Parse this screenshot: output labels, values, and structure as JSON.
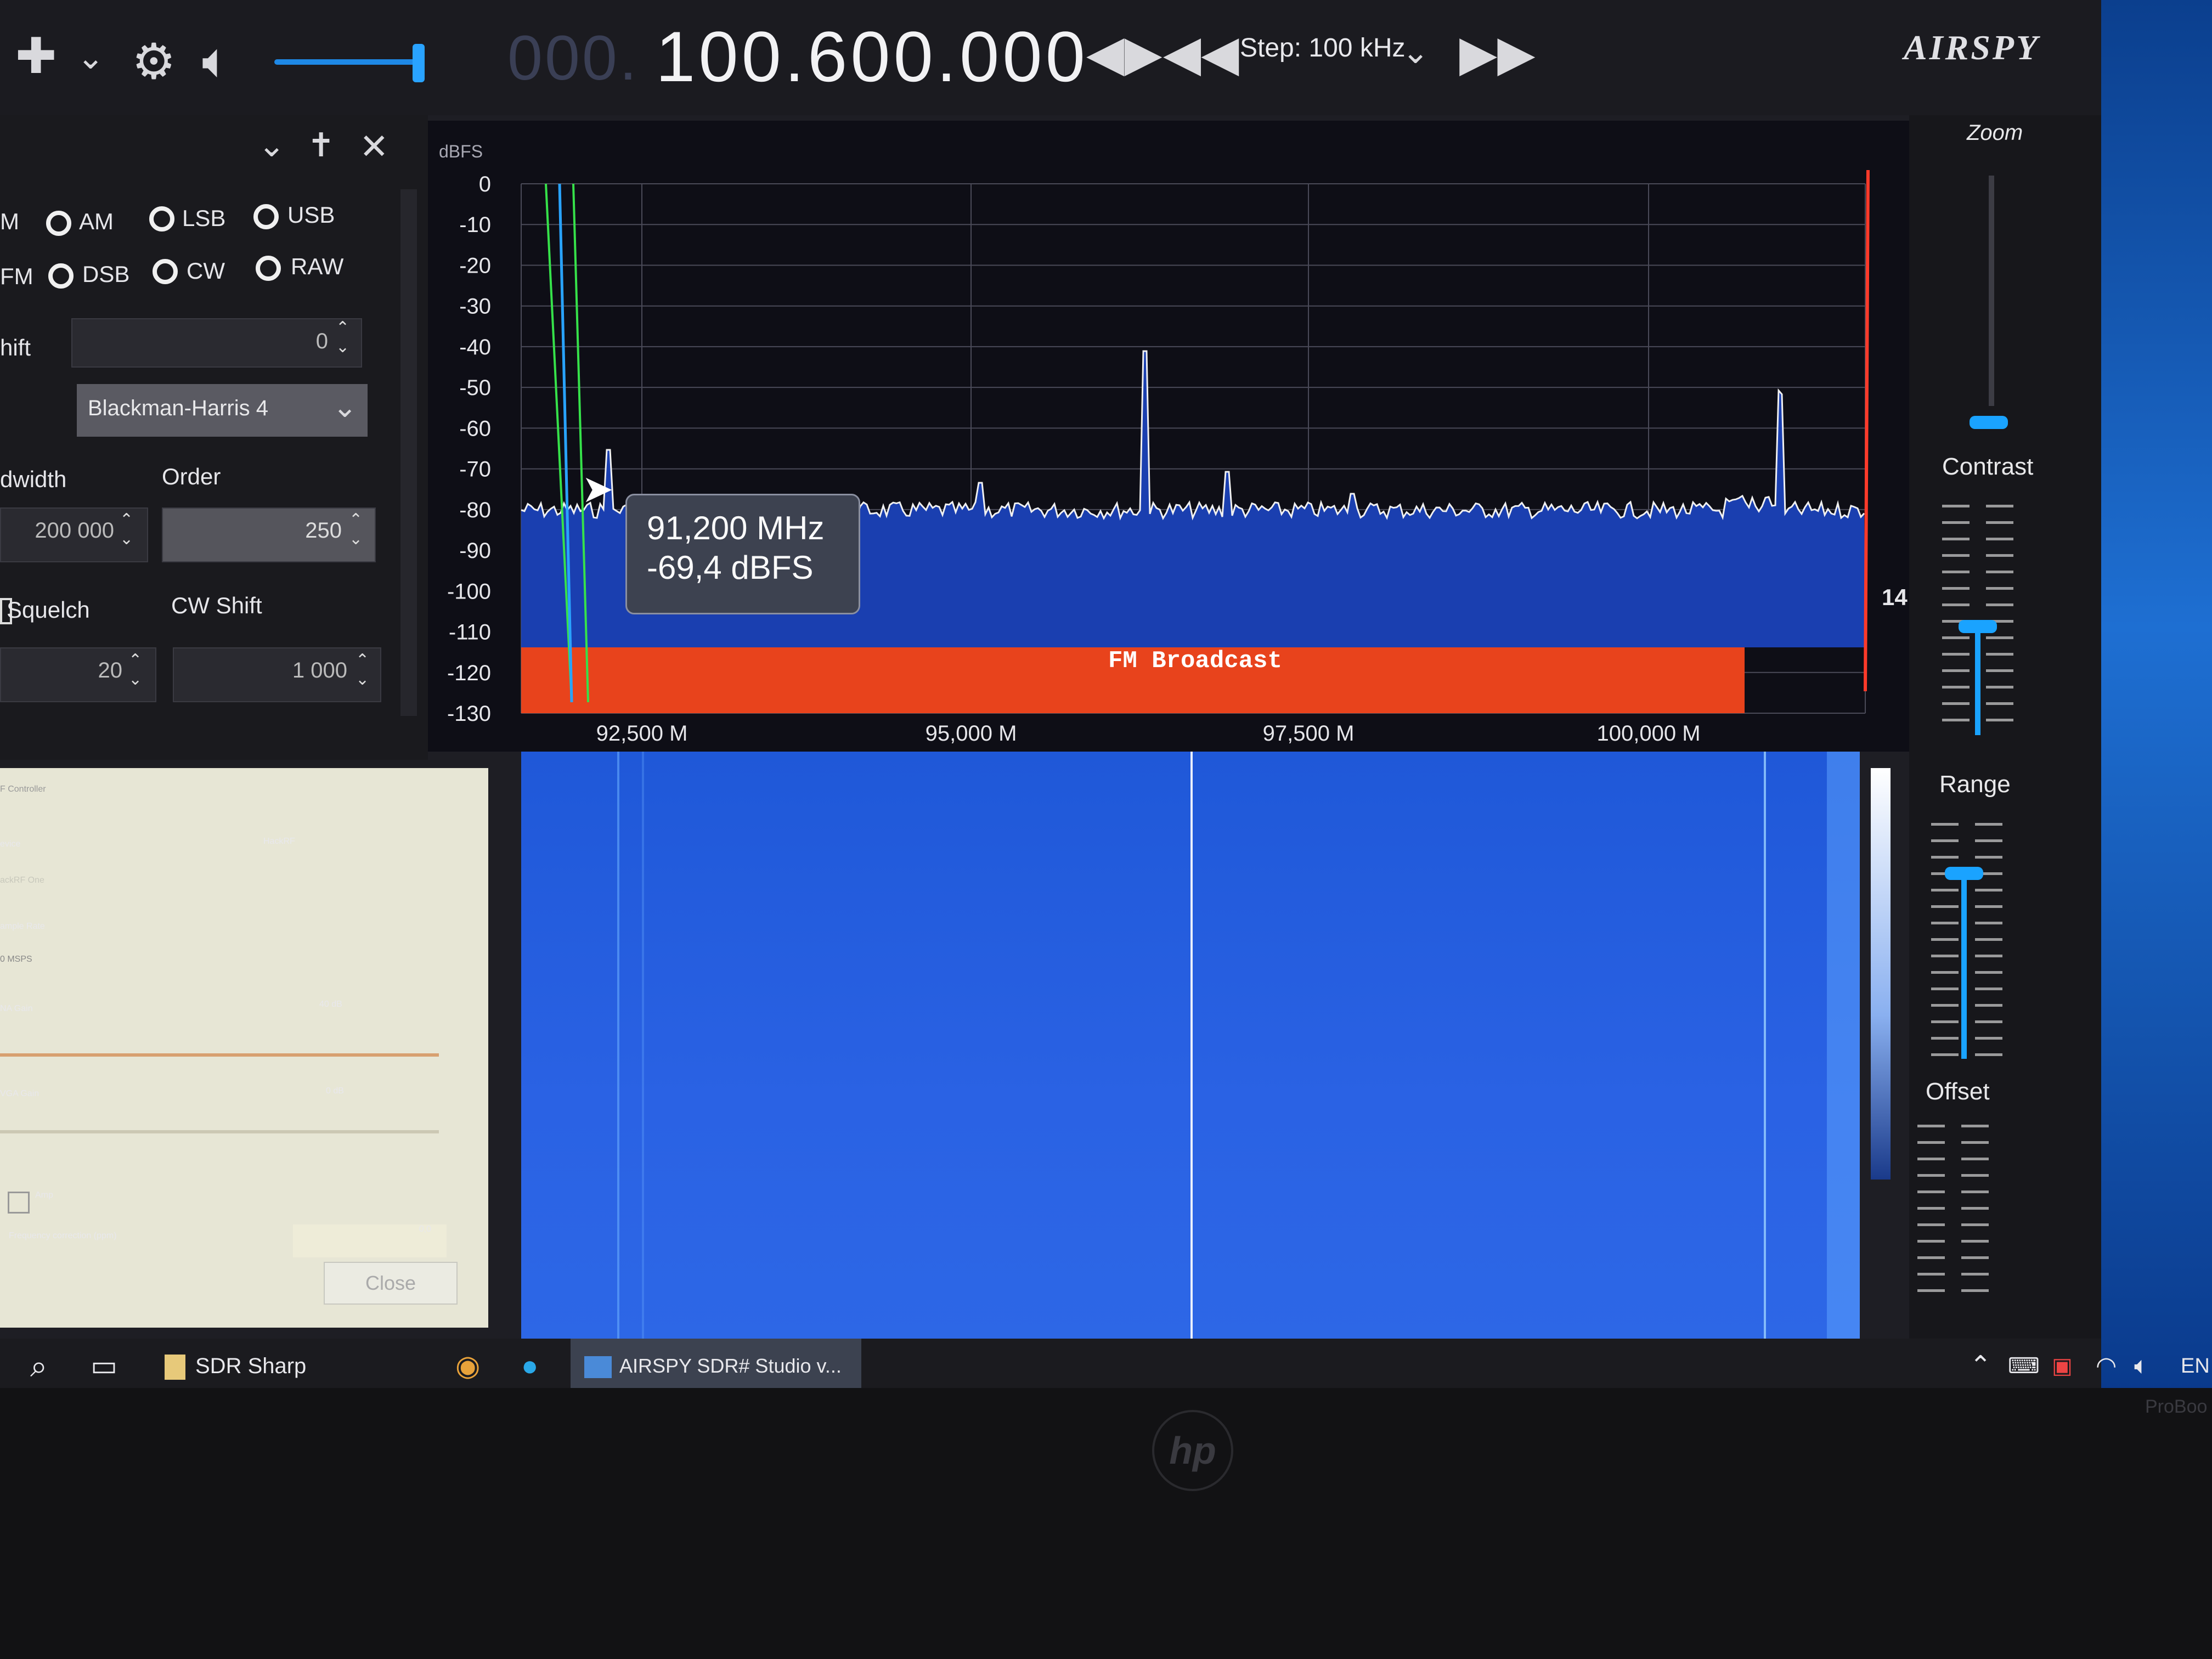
{
  "toolbar": {
    "frequency_dim": "000.",
    "frequency": "100.600.000",
    "step_label": "Step: 100 kHz",
    "logo": "AIRSPY"
  },
  "modes": [
    "M",
    "AM",
    "LSB",
    "USB",
    "FM",
    "DSB",
    "CW",
    "RAW"
  ],
  "radio_panel": {
    "shift_label": "hift",
    "shift_value": "0",
    "window_value": "Blackman-Harris 4",
    "bandwidth_label": "dwidth",
    "bandwidth_value": "200 000",
    "order_label": "Order",
    "order_value": "250",
    "squelch_label": "Squelch",
    "squelch_value": "20",
    "cwshift_label": "CW Shift",
    "cwshift_value": "1 000"
  },
  "frontend": {
    "title": "F Controller",
    "device_label": "evice",
    "device_value": "HackRF",
    "device_sub": "ackRF One",
    "sample_rate_label": "ample Rate",
    "sample_rate_value": "0 MSPS",
    "lna_label": "NA Gain",
    "lna_value": "40 dB",
    "vga_label": "VGA Gain",
    "vga_value": "0 dB",
    "amp_label": "Amp",
    "freqcorr_label": "Frequency correction (ppm)",
    "freqcorr_value": "0,0",
    "close_label": "Close"
  },
  "spectrum": {
    "unit": "dBFS",
    "y_labels": [
      "0",
      "-10",
      "-20",
      "-30",
      "-40",
      "-50",
      "-60",
      "-70",
      "-80",
      "-90",
      "-100",
      "-110",
      "-120",
      "-130"
    ],
    "x_labels": [
      "92,500 M",
      "95,000 M",
      "97,500 M",
      "100,000 M"
    ],
    "band_label": "FM Broadcast",
    "tooltip_freq": "91,200 MHz",
    "tooltip_level": "-69,4 dBFS",
    "side_value": "14",
    "colors": {
      "band": "#e8431c",
      "trace_fill": "#1a3fb0",
      "filter_green": "#36e24a",
      "filter_blue": "#29a3ff",
      "marker_red": "#ff3a2a"
    }
  },
  "zoom_panel": {
    "zoom": "Zoom",
    "contrast": "Contrast",
    "range": "Range",
    "offset": "Offset"
  },
  "taskbar": {
    "app1": "SDR Sharp",
    "app2": "AIRSPY SDR# Studio v...",
    "lang": "EN"
  },
  "bezel": {
    "brand": "hp",
    "model": "ProBoo"
  }
}
